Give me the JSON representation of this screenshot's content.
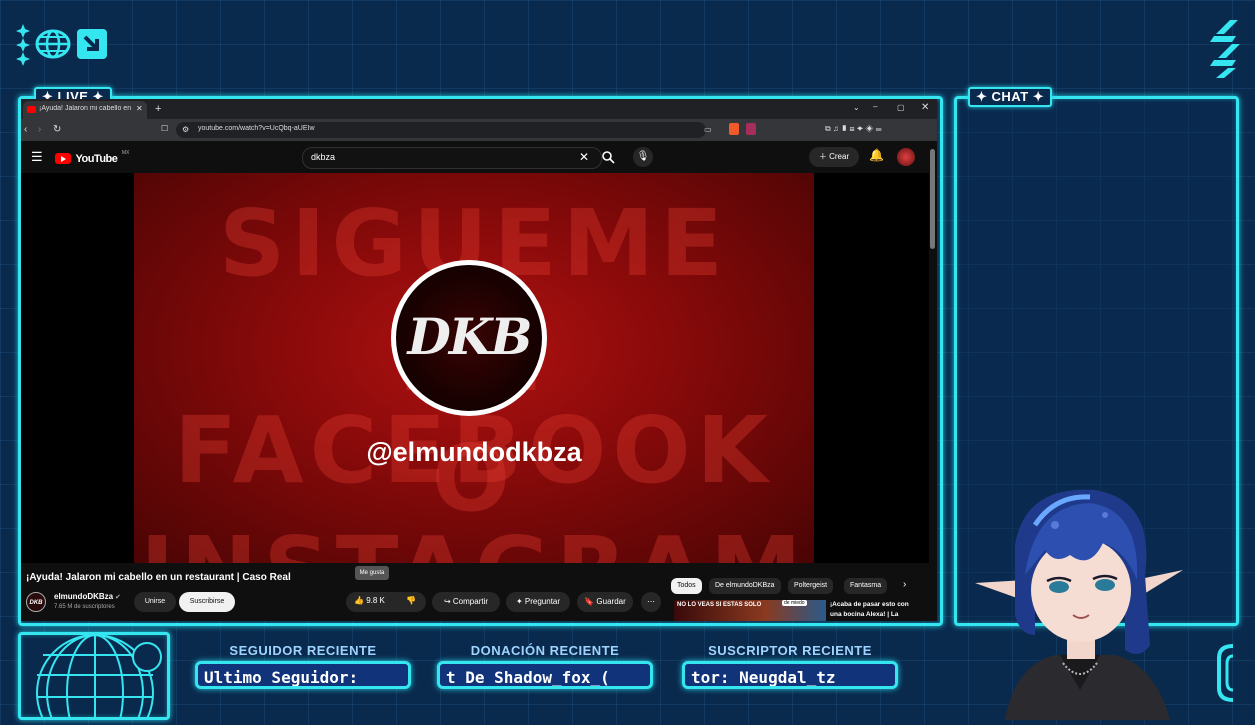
{
  "overlay": {
    "live_label": "LIVE",
    "chat_label": "CHAT",
    "follower_heading": "SEGUIDOR RECIENTE",
    "follower_value": "Ultimo Seguidor:",
    "donation_heading": "DONACIÓN RECIENTE",
    "donation_value": "t De Shadow_fox_(",
    "subscriber_heading": "SUSCRIPTOR RECIENTE",
    "subscriber_value": "tor: Neugdal_tz",
    "accent_color": "#35e6f0"
  },
  "browser": {
    "tab_title": "¡Ayuda! Jalaron mi cabello en",
    "url": "youtube.com/watch?v=UcQbq-aUEIw"
  },
  "youtube": {
    "logo_text": "YouTube",
    "region": "MX",
    "search_value": "dkbza",
    "create_label": "Crear",
    "video": {
      "title": "¡Ayuda! Jalaron mi cabello en un restaurant | Caso Real",
      "thumb_logo": "DKB",
      "thumb_handle": "@elmundodkbza",
      "thumb_bg_lines": [
        "SIGUEME",
        "EN FACEBOOK",
        "O INSTAGRAM"
      ]
    },
    "channel": {
      "avatar_text": "DKB",
      "name": "elmundoDKBza",
      "subscribers": "7.65 M de suscriptores",
      "join_label": "Unirse",
      "subscribe_label": "Suscribirse"
    },
    "tooltip": "Me gusta",
    "likes": "9.8 K",
    "actions": {
      "share": "Compartir",
      "ask": "Preguntar",
      "save": "Guardar"
    },
    "chips": [
      "Todos",
      "De elmundoDKBza",
      "Poltergeist",
      "Fantasma"
    ],
    "related": {
      "thumb_text": "NO LO VEAS SI ESTAS SOLO",
      "thumb_badge": "de miedo",
      "title_line1": "¡Acaba de pasar esto con",
      "title_line2": "una bocina Alexa! | La"
    }
  }
}
